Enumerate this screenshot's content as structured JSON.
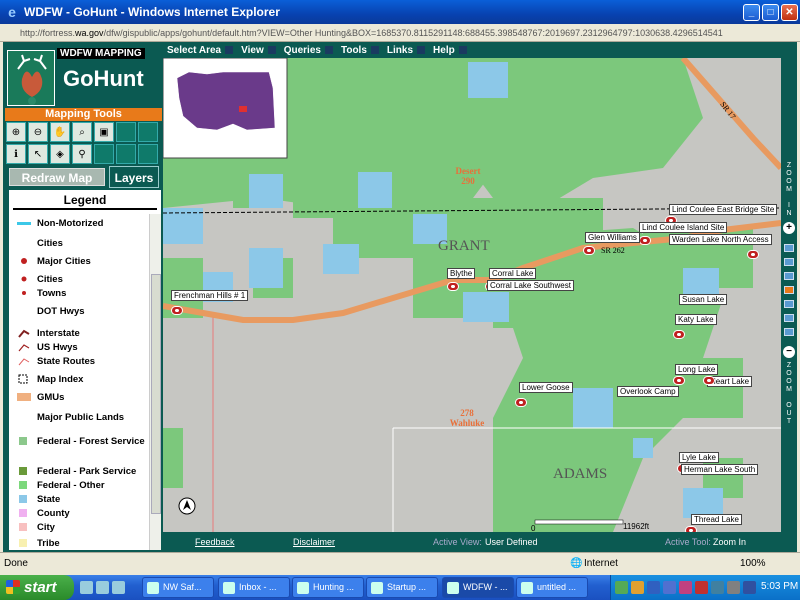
{
  "window": {
    "title": "WDFW - GoHunt - Windows Internet Explorer",
    "url_prefix": "http://fortress.",
    "url_domain": "wa.gov",
    "url_rest": "/dfw/gispublic/apps/gohunt/default.htm?VIEW=Other Hunting&BOX=1685370.8115291148:688455.398548767:2019697.2312964797:1030638.4296514541"
  },
  "app": {
    "brand": "WDFW MAPPING",
    "name": "GoHunt",
    "tools_heading": "Mapping Tools",
    "redraw_label": "Redraw Map",
    "layers_label": "Layers",
    "legend_title": "Legend",
    "legend": [
      {
        "label": "Non-Motorized",
        "sym": "cyan-bar"
      },
      {
        "label": "Cities",
        "sym": "none"
      },
      {
        "label": "Major Cities",
        "sym": "red-dot"
      },
      {
        "label": "Cities",
        "sym": "red-dot-small"
      },
      {
        "label": "Towns",
        "sym": "red-dot-tiny"
      },
      {
        "label": "DOT Hwys",
        "sym": "none"
      },
      {
        "label": "Interstate",
        "sym": "interstate"
      },
      {
        "label": "US Hwys",
        "sym": "ushwy"
      },
      {
        "label": "State Routes",
        "sym": "stroute"
      },
      {
        "label": "Map Index",
        "sym": "mapindex"
      },
      {
        "label": "GMUs",
        "sym": "orange-bar"
      },
      {
        "label": "Major Public Lands",
        "sym": "none"
      },
      {
        "label": "Federal - Forest Service",
        "sym": "forest"
      },
      {
        "label": "Federal - Park Service",
        "sym": "park"
      },
      {
        "label": "Federal - Other",
        "sym": "fedother"
      },
      {
        "label": "State",
        "sym": "state"
      },
      {
        "label": "County",
        "sym": "county"
      },
      {
        "label": "City",
        "sym": "city"
      },
      {
        "label": "Tribe",
        "sym": "tribe"
      }
    ],
    "menus": [
      "Select Area",
      "View",
      "Queries",
      "Tools",
      "Links",
      "Help"
    ]
  },
  "map": {
    "county_labels": [
      "GRANT",
      "ADAMS"
    ],
    "gmus": [
      {
        "num": "290",
        "name": "Desert"
      },
      {
        "num": "278",
        "name": "Wahluke"
      }
    ],
    "routes": [
      "SR 262",
      "SR 17"
    ],
    "sites": [
      "Lind Coulee East Bridge Site",
      "Lind Coulee Island Site",
      "Glen Williams",
      "Warden Lake North Access",
      "Blythe",
      "Corral Lake",
      "Corral Lake Southwest",
      "Frenchman Hills # 1",
      "Susan Lake",
      "Katy Lake",
      "Long Lake",
      "Heart Lake",
      "Overlook Camp",
      "Lower Goose",
      "Lyle Lake",
      "Herman Lake South",
      "Thread Lake"
    ],
    "scale_zero": "0",
    "scale_max": "11962ft",
    "zoom_in_text": "ZOOM IN",
    "zoom_out_text": "ZOOM OUT"
  },
  "footer": {
    "feedback": "Feedback",
    "disclaimer": "Disclaimer",
    "active_view_label": "Active View:",
    "active_view_value": "User Defined",
    "active_tool_label": "Active Tool:",
    "active_tool_value": "Zoom In"
  },
  "status": {
    "text": "Done",
    "zone": "Internet",
    "zoom": "100%"
  },
  "taskbar": {
    "start": "start",
    "tasks": [
      "NW Saf...",
      "Inbox - ...",
      "Hunting ...",
      "Startup ...",
      "WDFW - ...",
      "untitled ..."
    ],
    "clock": "5:03 PM"
  },
  "colors": {
    "app_bg": "#0b5a52",
    "accent_orange": "#e87a1a",
    "public_land_green": "#7cc87c",
    "state_blue": "#8cc8e8",
    "gmu_label": "#e8703a"
  }
}
